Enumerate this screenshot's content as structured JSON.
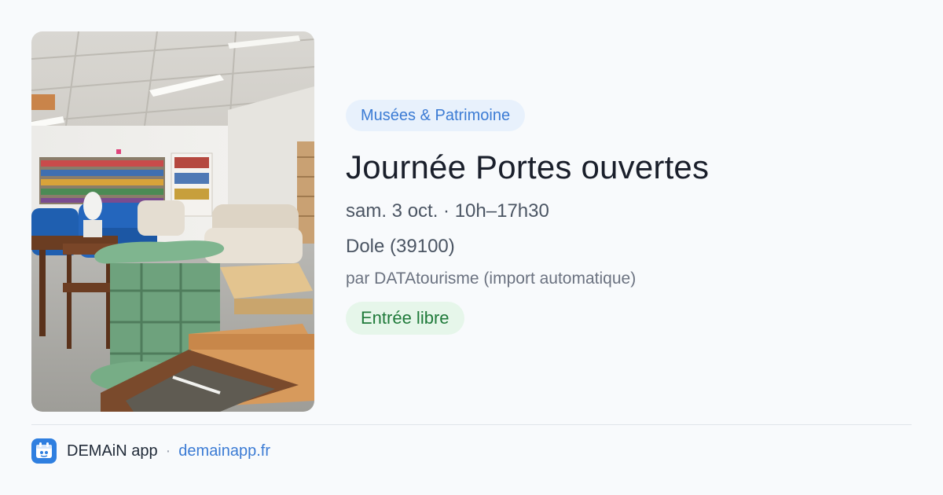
{
  "event": {
    "category": "Musées & Patrimoine",
    "title": "Journée Portes ouvertes",
    "date": "sam. 3 oct. · 10h–17h30",
    "place": "Dole (39100)",
    "source": "par DATAtourisme (import automatique)",
    "price": "Entrée libre",
    "image_alt": "photo-showroom-furniture"
  },
  "footer": {
    "app_name": "DEMAiN app",
    "separator": "·",
    "url": "demainapp.fr",
    "icon": "demain-app-icon"
  },
  "colors": {
    "category_bg": "#e8f1fc",
    "category_text": "#3b7bd4",
    "price_bg": "#e6f6ea",
    "price_text": "#1f7a3a",
    "link": "#3b7bd4"
  }
}
